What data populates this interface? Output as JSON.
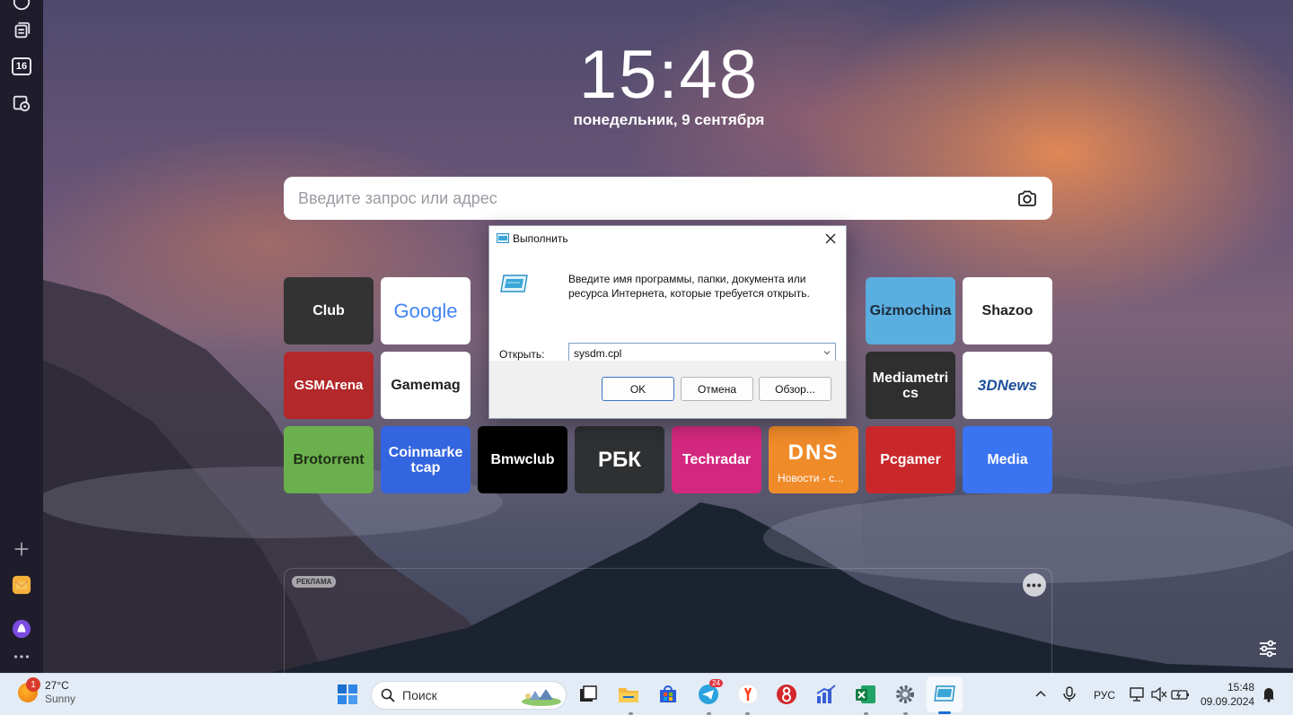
{
  "newtab": {
    "clock": "15:48",
    "date": "понедельник, 9 сентября",
    "search_placeholder": "Введите запрос или адрес",
    "tiles": [
      {
        "label": "Club",
        "bg": "#333333",
        "fg": "#ffffff"
      },
      {
        "label": "Google",
        "bg": "#ffffff",
        "fg": "#4285f4"
      },
      {
        "label": "Gizmochina",
        "bg": "#5aafe0",
        "fg": "#1d2b3a"
      },
      {
        "label": "Shazoo",
        "bg": "#ffffff",
        "fg": "#222222"
      },
      {
        "label": "GSMArena",
        "bg": "#b3282a",
        "fg": "#ffffff"
      },
      {
        "label": "Gamemag",
        "bg": "#ffffff",
        "fg": "#222222"
      },
      {
        "label": "Mediametrics",
        "bg": "#2f2f2f",
        "fg": "#ffffff"
      },
      {
        "label": "3DNews",
        "bg": "#ffffff",
        "fg": "#1d4f9a"
      },
      {
        "label": "Brotorrent",
        "bg": "#6ab04c",
        "fg": "#1f2d16"
      },
      {
        "label": "Coinmarketcap",
        "bg": "#3465e0",
        "fg": "#ffffff"
      },
      {
        "label": "Bmwclub",
        "bg": "#000000",
        "fg": "#ffffff"
      },
      {
        "label": "РБК",
        "bg": "#2e3032",
        "fg": "#ffffff"
      },
      {
        "label": "Techradar",
        "bg": "#d3287f",
        "fg": "#ffffff"
      },
      {
        "label": "DNS",
        "sub": "Новости - с...",
        "bg": "#f08b2a",
        "fg": "#ffffff"
      },
      {
        "label": "Pcgamer",
        "bg": "#c9282a",
        "fg": "#ffffff"
      },
      {
        "label": "Media",
        "bg": "#3b74f0",
        "fg": "#ffffff"
      }
    ],
    "ad_badge": "РЕКЛАМА",
    "ad_more": "•••"
  },
  "sidebar": {
    "tabs_count": "16"
  },
  "run_dialog": {
    "title": "Выполнить",
    "description": "Введите имя программы, папки, документа или ресурса Интернета, которые требуется открыть.",
    "open_label": "Открыть:",
    "input_value": "sysdm.cpl",
    "ok_label": "OK",
    "cancel_label": "Отмена",
    "browse_label": "Обзор..."
  },
  "taskbar": {
    "weather_temp": "27°C",
    "weather_cond": "Sunny",
    "weather_badge": "1",
    "search_label": "Поиск",
    "telegram_badge": "24",
    "lang": "РУС",
    "time": "15:48",
    "date": "09.09.2024"
  },
  "colors": {
    "accent": "#1a6fd1",
    "taskbar_bg": "#e3ecf6",
    "sidebar_bg": "#1f1d2b"
  }
}
